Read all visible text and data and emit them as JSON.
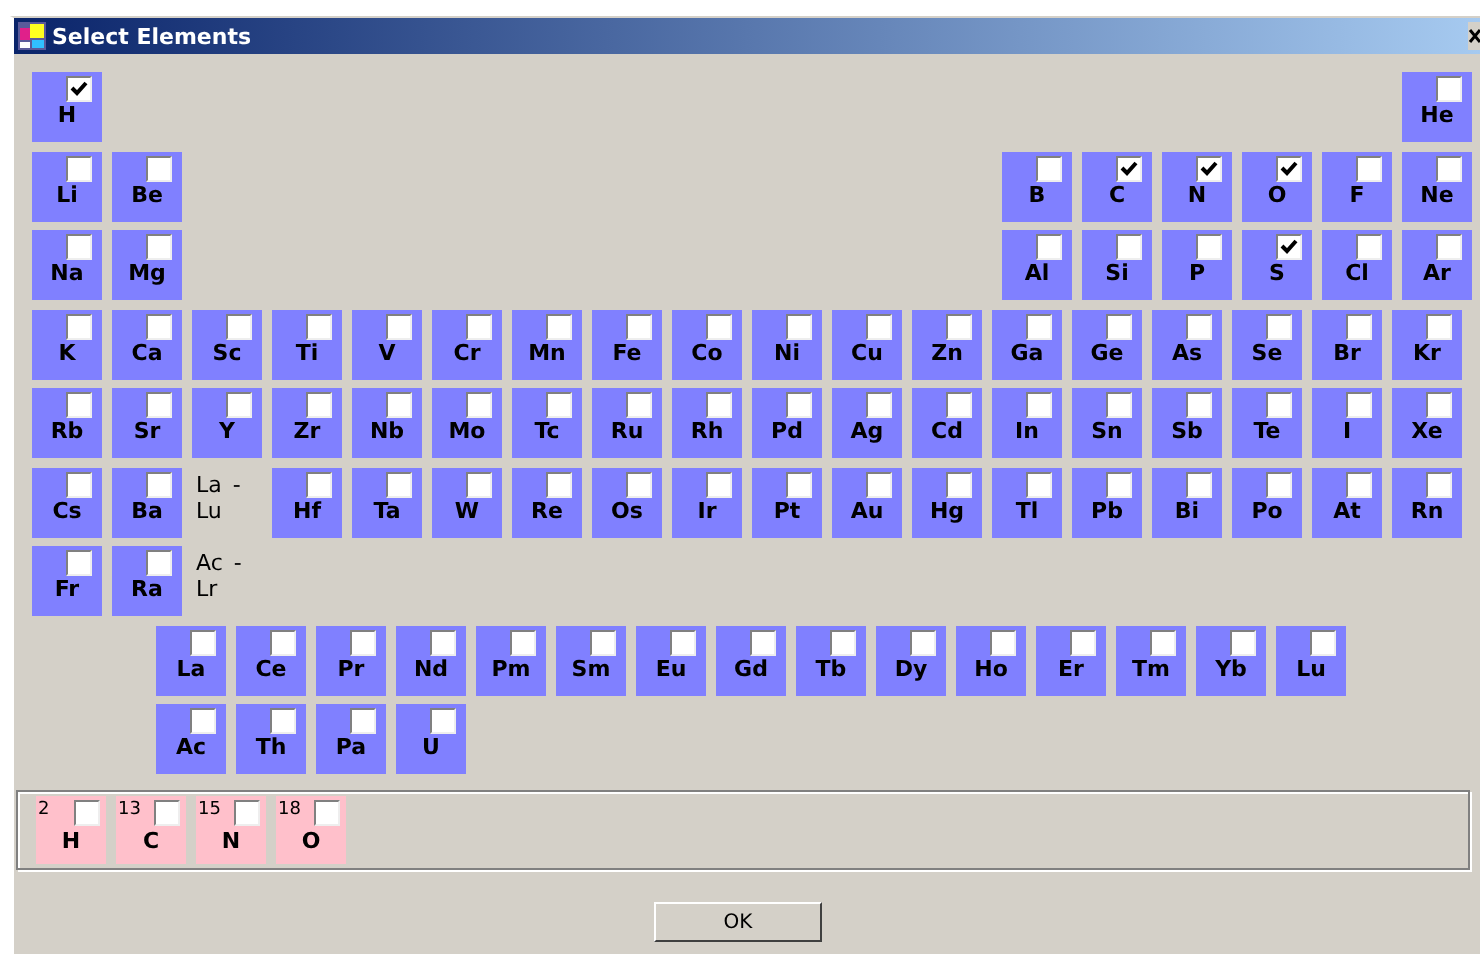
{
  "window": {
    "title": "Select Elements"
  },
  "table_rows": [
    {
      "left": [
        {
          "kind": "element",
          "symbol": "H",
          "checked": true
        }
      ],
      "right": [
        {
          "kind": "element",
          "symbol": "He",
          "checked": false
        }
      ]
    },
    {
      "left": [
        {
          "kind": "element",
          "symbol": "Li",
          "checked": false
        },
        {
          "kind": "element",
          "symbol": "Be",
          "checked": false
        }
      ],
      "right": [
        {
          "kind": "element",
          "symbol": "B",
          "checked": false
        },
        {
          "kind": "element",
          "symbol": "C",
          "checked": true
        },
        {
          "kind": "element",
          "symbol": "N",
          "checked": true
        },
        {
          "kind": "element",
          "symbol": "O",
          "checked": true
        },
        {
          "kind": "element",
          "symbol": "F",
          "checked": false
        },
        {
          "kind": "element",
          "symbol": "Ne",
          "checked": false
        }
      ]
    },
    {
      "left": [
        {
          "kind": "element",
          "symbol": "Na",
          "checked": false
        },
        {
          "kind": "element",
          "symbol": "Mg",
          "checked": false
        }
      ],
      "right": [
        {
          "kind": "element",
          "symbol": "Al",
          "checked": false
        },
        {
          "kind": "element",
          "symbol": "Si",
          "checked": false
        },
        {
          "kind": "element",
          "symbol": "P",
          "checked": false
        },
        {
          "kind": "element",
          "symbol": "S",
          "checked": true
        },
        {
          "kind": "element",
          "symbol": "Cl",
          "checked": false
        },
        {
          "kind": "element",
          "symbol": "Ar",
          "checked": false
        }
      ]
    },
    {
      "left": [
        {
          "kind": "element",
          "symbol": "K",
          "checked": false
        },
        {
          "kind": "element",
          "symbol": "Ca",
          "checked": false
        },
        {
          "kind": "element",
          "symbol": "Sc",
          "checked": false
        },
        {
          "kind": "element",
          "symbol": "Ti",
          "checked": false
        },
        {
          "kind": "element",
          "symbol": "V",
          "checked": false
        },
        {
          "kind": "element",
          "symbol": "Cr",
          "checked": false
        },
        {
          "kind": "element",
          "symbol": "Mn",
          "checked": false
        },
        {
          "kind": "element",
          "symbol": "Fe",
          "checked": false
        },
        {
          "kind": "element",
          "symbol": "Co",
          "checked": false
        },
        {
          "kind": "element",
          "symbol": "Ni",
          "checked": false
        },
        {
          "kind": "element",
          "symbol": "Cu",
          "checked": false
        },
        {
          "kind": "element",
          "symbol": "Zn",
          "checked": false
        },
        {
          "kind": "element",
          "symbol": "Ga",
          "checked": false
        },
        {
          "kind": "element",
          "symbol": "Ge",
          "checked": false
        },
        {
          "kind": "element",
          "symbol": "As",
          "checked": false
        },
        {
          "kind": "element",
          "symbol": "Se",
          "checked": false
        },
        {
          "kind": "element",
          "symbol": "Br",
          "checked": false
        },
        {
          "kind": "element",
          "symbol": "Kr",
          "checked": false
        }
      ],
      "right": []
    },
    {
      "left": [
        {
          "kind": "element",
          "symbol": "Rb",
          "checked": false
        },
        {
          "kind": "element",
          "symbol": "Sr",
          "checked": false
        },
        {
          "kind": "element",
          "symbol": "Y",
          "checked": false
        },
        {
          "kind": "element",
          "symbol": "Zr",
          "checked": false
        },
        {
          "kind": "element",
          "symbol": "Nb",
          "checked": false
        },
        {
          "kind": "element",
          "symbol": "Mo",
          "checked": false
        },
        {
          "kind": "element",
          "symbol": "Tc",
          "checked": false
        },
        {
          "kind": "element",
          "symbol": "Ru",
          "checked": false
        },
        {
          "kind": "element",
          "symbol": "Rh",
          "checked": false
        },
        {
          "kind": "element",
          "symbol": "Pd",
          "checked": false
        },
        {
          "kind": "element",
          "symbol": "Ag",
          "checked": false
        },
        {
          "kind": "element",
          "symbol": "Cd",
          "checked": false
        },
        {
          "kind": "element",
          "symbol": "In",
          "checked": false
        },
        {
          "kind": "element",
          "symbol": "Sn",
          "checked": false
        },
        {
          "kind": "element",
          "symbol": "Sb",
          "checked": false
        },
        {
          "kind": "element",
          "symbol": "Te",
          "checked": false
        },
        {
          "kind": "element",
          "symbol": "I",
          "checked": false
        },
        {
          "kind": "element",
          "symbol": "Xe",
          "checked": false
        }
      ],
      "right": []
    },
    {
      "left": [
        {
          "kind": "element",
          "symbol": "Cs",
          "checked": false
        },
        {
          "kind": "element",
          "symbol": "Ba",
          "checked": false
        },
        {
          "kind": "label",
          "text": "La - Lu"
        },
        {
          "kind": "element",
          "symbol": "Hf",
          "checked": false
        },
        {
          "kind": "element",
          "symbol": "Ta",
          "checked": false
        },
        {
          "kind": "element",
          "symbol": "W",
          "checked": false
        },
        {
          "kind": "element",
          "symbol": "Re",
          "checked": false
        },
        {
          "kind": "element",
          "symbol": "Os",
          "checked": false
        },
        {
          "kind": "element",
          "symbol": "Ir",
          "checked": false
        },
        {
          "kind": "element",
          "symbol": "Pt",
          "checked": false
        },
        {
          "kind": "element",
          "symbol": "Au",
          "checked": false
        },
        {
          "kind": "element",
          "symbol": "Hg",
          "checked": false
        },
        {
          "kind": "element",
          "symbol": "Tl",
          "checked": false
        },
        {
          "kind": "element",
          "symbol": "Pb",
          "checked": false
        },
        {
          "kind": "element",
          "symbol": "Bi",
          "checked": false
        },
        {
          "kind": "element",
          "symbol": "Po",
          "checked": false
        },
        {
          "kind": "element",
          "symbol": "At",
          "checked": false
        },
        {
          "kind": "element",
          "symbol": "Rn",
          "checked": false
        }
      ],
      "right": []
    },
    {
      "left": [
        {
          "kind": "element",
          "symbol": "Fr",
          "checked": false
        },
        {
          "kind": "element",
          "symbol": "Ra",
          "checked": false
        },
        {
          "kind": "label",
          "text": "Ac - Lr"
        }
      ],
      "right": []
    }
  ],
  "series_rows": [
    [
      {
        "symbol": "La",
        "checked": false
      },
      {
        "symbol": "Ce",
        "checked": false
      },
      {
        "symbol": "Pr",
        "checked": false
      },
      {
        "symbol": "Nd",
        "checked": false
      },
      {
        "symbol": "Pm",
        "checked": false
      },
      {
        "symbol": "Sm",
        "checked": false
      },
      {
        "symbol": "Eu",
        "checked": false
      },
      {
        "symbol": "Gd",
        "checked": false
      },
      {
        "symbol": "Tb",
        "checked": false
      },
      {
        "symbol": "Dy",
        "checked": false
      },
      {
        "symbol": "Ho",
        "checked": false
      },
      {
        "symbol": "Er",
        "checked": false
      },
      {
        "symbol": "Tm",
        "checked": false
      },
      {
        "symbol": "Yb",
        "checked": false
      },
      {
        "symbol": "Lu",
        "checked": false
      }
    ],
    [
      {
        "symbol": "Ac",
        "checked": false
      },
      {
        "symbol": "Th",
        "checked": false
      },
      {
        "symbol": "Pa",
        "checked": false
      },
      {
        "symbol": "U",
        "checked": false
      }
    ]
  ],
  "isotopes": [
    {
      "number": "2",
      "symbol": "H",
      "checked": false
    },
    {
      "number": "13",
      "symbol": "C",
      "checked": false
    },
    {
      "number": "15",
      "symbol": "N",
      "checked": false
    },
    {
      "number": "18",
      "symbol": "O",
      "checked": false
    }
  ],
  "buttons": [
    "OK"
  ]
}
